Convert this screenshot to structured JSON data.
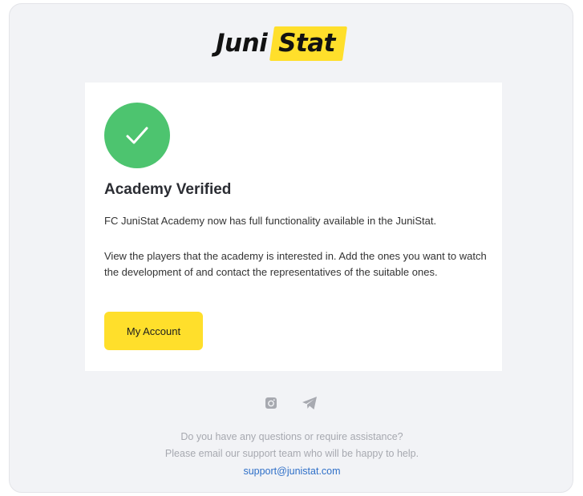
{
  "logo": {
    "part1": "Juni",
    "part2": "Stat"
  },
  "card": {
    "title": "Academy Verified",
    "line1": "FC JuniStat Academy now has full functionality available in the JuniStat.",
    "line2": "View the players that the academy is interested in. Add the ones you want to watch the development of and contact the representatives of the suitable ones.",
    "button_label": "My Account"
  },
  "social": {
    "icons": [
      "instagram-icon",
      "telegram-icon"
    ]
  },
  "footer": {
    "question": "Do you have any questions or require assistance?",
    "email_prompt": "Please email our support team who will be happy to help.",
    "email": "support@junistat.com"
  },
  "colors": {
    "accent": "#ffdf2b",
    "success": "#4dc46f",
    "background": "#f2f3f6",
    "link": "#2e6fc8"
  }
}
